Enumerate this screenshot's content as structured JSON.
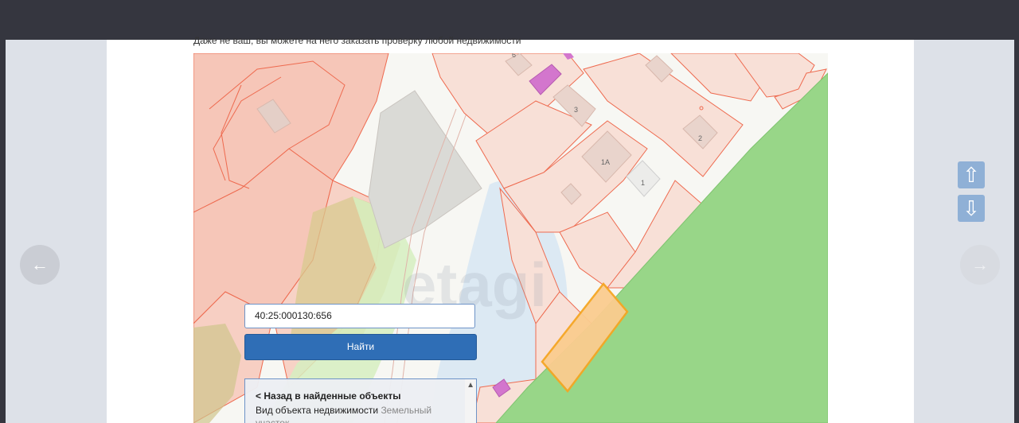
{
  "caption": "Даже не ваш, вы можете на него заказать проверку любой недвижимости",
  "map": {
    "watermark": "etagi",
    "building_labels": [
      "6",
      "3",
      "2",
      "1А",
      "1"
    ],
    "colors": {
      "parcel_fill": "#f7d8cf",
      "parcel_stroke": "#ee6a4f",
      "green_zone": "#98d688",
      "light_green": "#d6efc0",
      "water": "#dce9f3",
      "gray_parcel": "#dadad6",
      "highlight": "#f5a623",
      "building": "#e9d4cc",
      "magenta": "#d376cd"
    }
  },
  "search": {
    "input_value": "40:25:000130:656",
    "button_label": "Найти"
  },
  "result": {
    "back_label": "< Назад в найденные объекты",
    "property_label": "Вид объекта недвижимости",
    "property_value": "Земельный участок"
  },
  "nav": {
    "prev_icon": "arrow-left-icon",
    "next_icon": "arrow-right-icon",
    "scroll_up_icon": "arrow-up-icon",
    "scroll_down_icon": "arrow-down-icon"
  }
}
